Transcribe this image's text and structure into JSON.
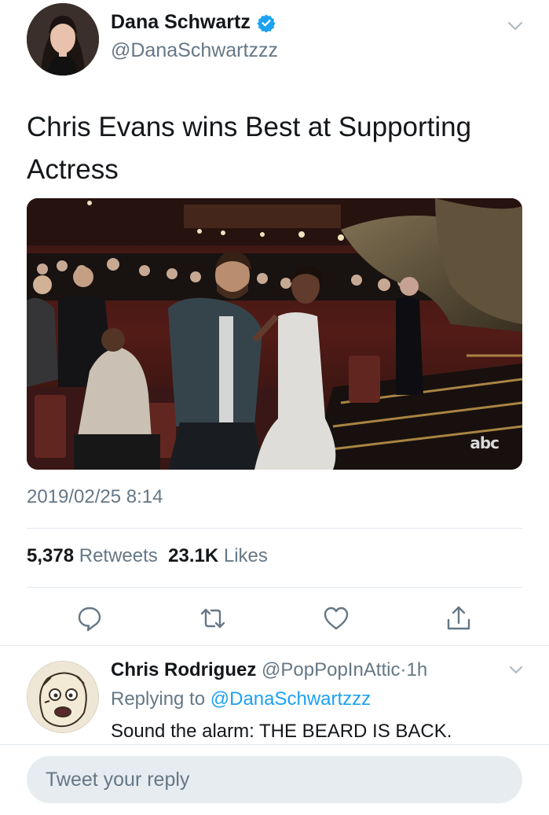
{
  "tweet": {
    "author_name": "Dana Schwartz",
    "author_handle": "@DanaSchwartzzz",
    "text": "Chris Evans wins Best at Supporting Actress",
    "media_watermark": "abc",
    "timestamp": "2019/02/25 8:14",
    "retweet_count": "5,378",
    "retweet_label": "Retweets",
    "like_count": "23.1K",
    "like_label": "Likes"
  },
  "actions": [
    "reply-icon",
    "retweet-icon",
    "like-icon",
    "share-icon"
  ],
  "reply": {
    "author_name": "Chris Rodriguez",
    "author_handle": "@PopPopInAttic",
    "separator": "·",
    "time": "1h",
    "replying_prefix": "Replying to",
    "replying_to": "@DanaSchwartzzz",
    "text": "Sound the alarm: THE BEARD IS BACK."
  },
  "compose": {
    "placeholder": "Tweet your reply"
  },
  "colors": {
    "accent": "#1da1f2",
    "secondary_text": "#657786",
    "primary_text": "#14171a"
  }
}
